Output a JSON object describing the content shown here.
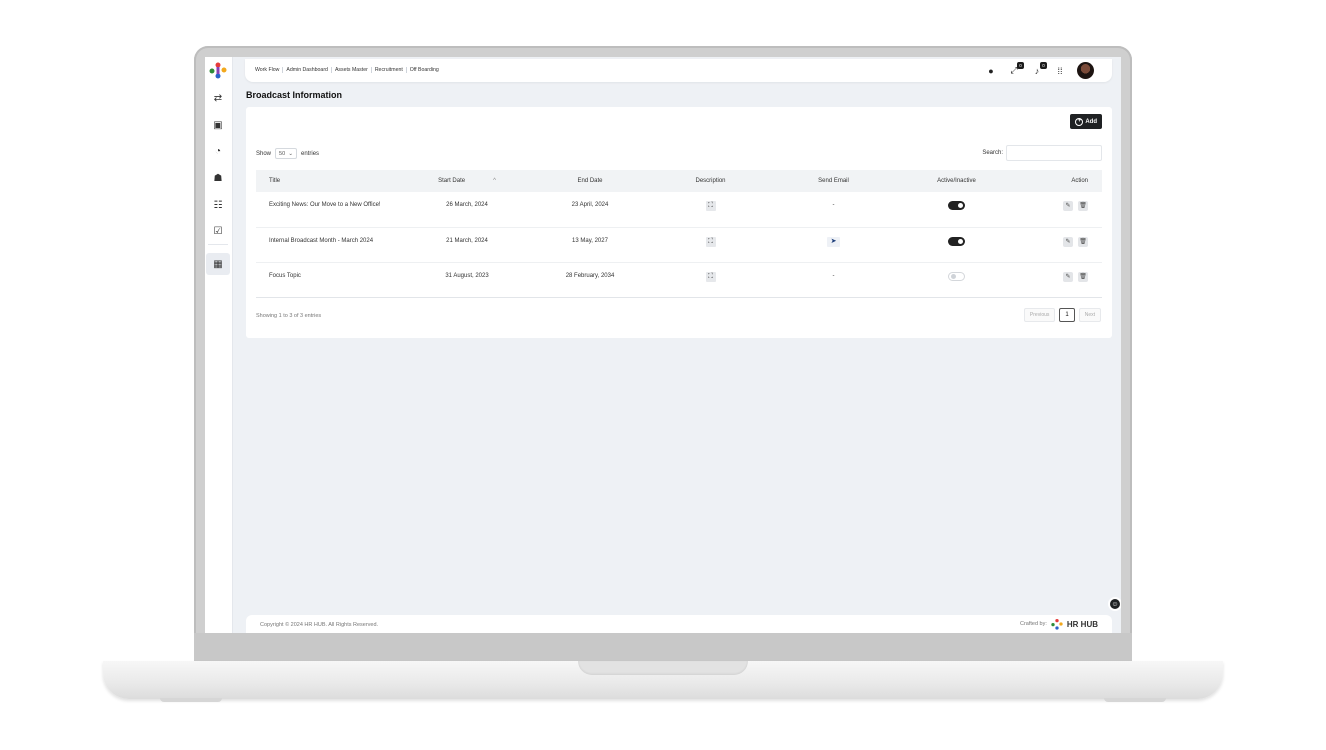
{
  "topbar": {
    "nav": [
      "Work Flow",
      "Admin Dashboard",
      "Assets Master",
      "Recruitment",
      "Off Boarding"
    ],
    "icons": [
      "chat-icon",
      "expand-icon",
      "bell-icon",
      "apps-icon"
    ],
    "badges": {
      "expand": "0",
      "bell": "0"
    }
  },
  "page": {
    "title": "Broadcast Information"
  },
  "toolbar": {
    "add_label": "Add"
  },
  "length_menu": {
    "show": "Show",
    "value": "50",
    "entries": "entries"
  },
  "search": {
    "label": "Search:",
    "value": ""
  },
  "table": {
    "columns": [
      "Title",
      "Start Date",
      "End Date",
      "Description",
      "Send Email",
      "Active/Inactive",
      "Action"
    ],
    "rows": [
      {
        "title": "Exciting News: Our Move to a New Office!",
        "start": "26 March, 2024",
        "end": "23 April, 2024",
        "send_email": "-",
        "active": true
      },
      {
        "title": "Internal Broadcast Month - March 2024",
        "start": "21 March, 2024",
        "end": "13 May, 2027",
        "send_email": "send-icon",
        "active": true
      },
      {
        "title": "Focus Topic",
        "start": "31 August, 2023",
        "end": "28 February, 2034",
        "send_email": "-",
        "active": false
      }
    ]
  },
  "pagination": {
    "info": "Showing 1 to 3 of 3 entries",
    "previous": "Previous",
    "current": "1",
    "next": "Next"
  },
  "footer": {
    "copyright": "Copyright © 2024 HR HUB. All Rights Reserved.",
    "crafted": "Crafted by:",
    "brand": "HR HUB"
  },
  "colors": {
    "primary_dark": "#1f2123",
    "background": "#eef1f5",
    "send_icon": "#1c3d7a"
  }
}
